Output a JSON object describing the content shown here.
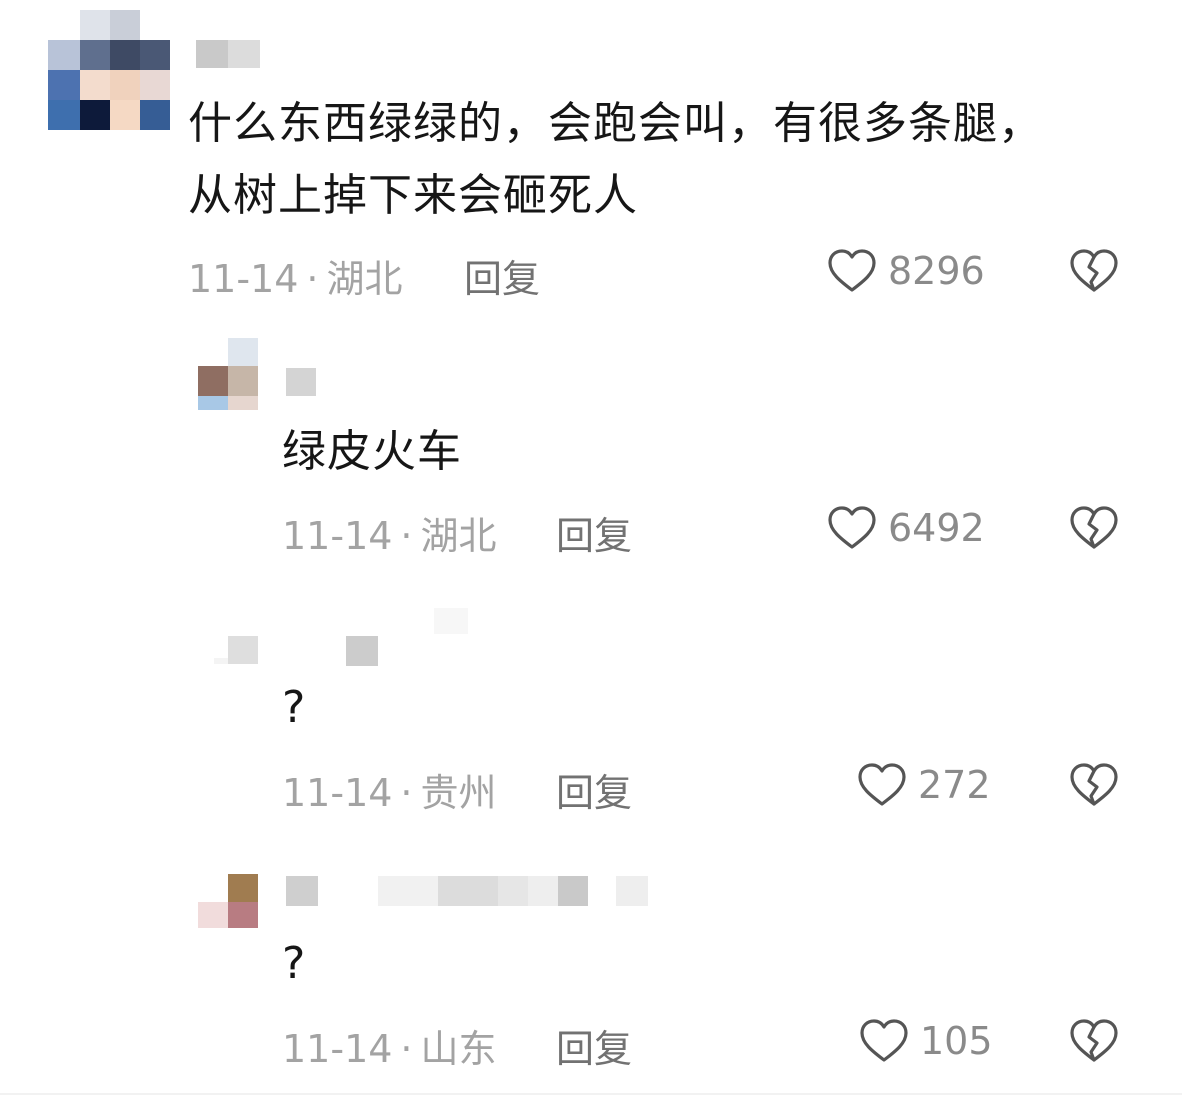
{
  "comments": [
    {
      "text": "什么东西绿绿的，会跑会叫，有很多条腿，从树上掉下来会砸死人",
      "date": "11-14",
      "separator": "·",
      "location": "湖北",
      "reply_label": "回复",
      "likes": "8296"
    },
    {
      "text": "绿皮火车",
      "date": "11-14",
      "separator": "·",
      "location": "湖北",
      "reply_label": "回复",
      "likes": "6492"
    },
    {
      "text": "?",
      "date": "11-14",
      "separator": "·",
      "location": "贵州",
      "reply_label": "回复",
      "likes": "272"
    },
    {
      "text": "?",
      "date": "11-14",
      "separator": "·",
      "location": "山东",
      "reply_label": "回复",
      "likes": "105"
    }
  ],
  "icons": {
    "like": "heart-outline-icon",
    "dislike": "broken-heart-icon"
  },
  "colors": {
    "text": "#161616",
    "meta": "#a3a3a3",
    "reply": "#727272",
    "icon": "#555555"
  }
}
